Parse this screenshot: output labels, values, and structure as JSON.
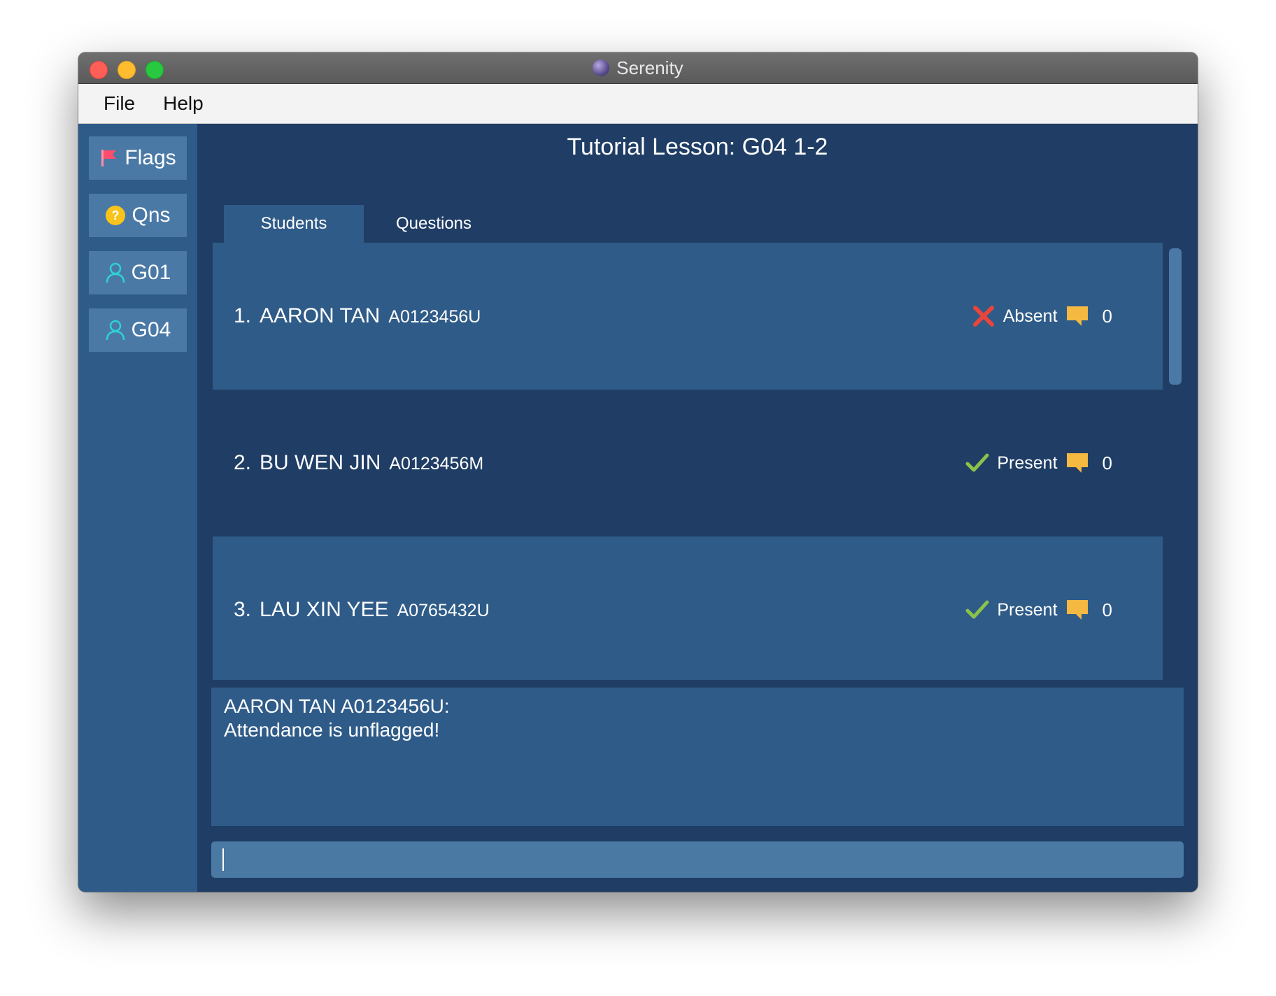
{
  "window": {
    "title": "Serenity"
  },
  "menubar": {
    "items": [
      {
        "label": "File"
      },
      {
        "label": "Help"
      }
    ]
  },
  "sidebar": {
    "items": [
      {
        "label": "Flags",
        "icon": "flag-icon"
      },
      {
        "label": "Qns",
        "icon": "question-icon"
      },
      {
        "label": "G01",
        "icon": "person-icon"
      },
      {
        "label": "G04",
        "icon": "person-icon"
      }
    ]
  },
  "main": {
    "lesson_title": "Tutorial Lesson: G04 1-2",
    "tabs": [
      {
        "label": "Students",
        "active": true
      },
      {
        "label": "Questions",
        "active": false
      }
    ],
    "students": [
      {
        "index": "1.",
        "name": "AARON TAN",
        "id": "A0123456U",
        "status": "Absent",
        "status_icon": "cross-icon",
        "questions": "0"
      },
      {
        "index": "2.",
        "name": "BU WEN JIN",
        "id": "A0123456M",
        "status": "Present",
        "status_icon": "check-icon",
        "questions": "0"
      },
      {
        "index": "3.",
        "name": "LAU XIN YEE",
        "id": "A0765432U",
        "status": "Present",
        "status_icon": "check-icon",
        "questions": "0"
      }
    ],
    "result": {
      "line1": "AARON TAN A0123456U:",
      "line2": "Attendance is unflagged!"
    },
    "command": {
      "value": "",
      "placeholder": ""
    }
  },
  "colors": {
    "main_bg": "#1f3d65",
    "panel_bg": "#2f5b88",
    "button_bg": "#4a79a6",
    "absent_red": "#e8453c",
    "present_green": "#8bc34a",
    "bubble_orange": "#f5b942",
    "person_cyan": "#2fd1d6",
    "flag_red": "#ff4d6d",
    "question_yellow": "#f8c31a"
  }
}
